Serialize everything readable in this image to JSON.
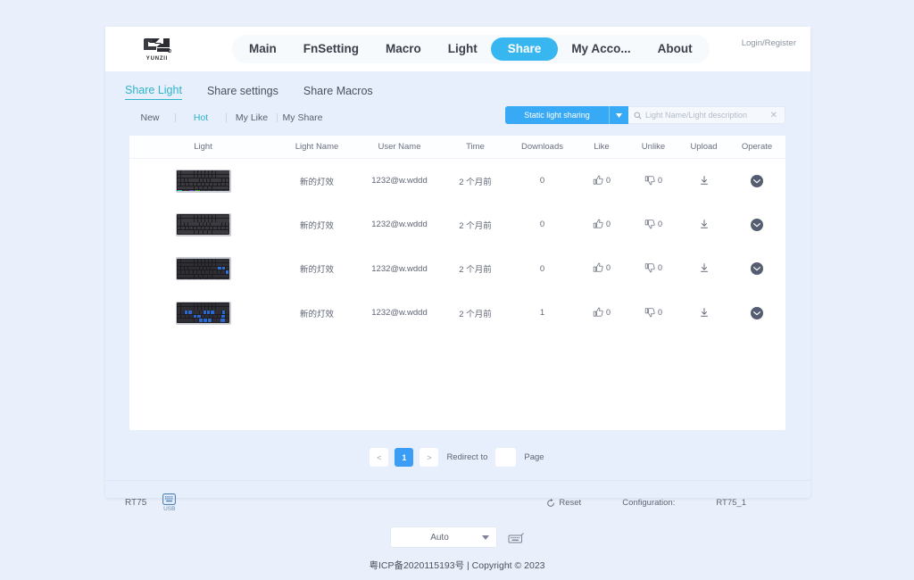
{
  "header": {
    "logo_text": "YUNZII",
    "logo_icon": "yunzii-logo-icon",
    "nav": [
      {
        "label": "Main",
        "active": false
      },
      {
        "label": "FnSetting",
        "active": false
      },
      {
        "label": "Macro",
        "active": false
      },
      {
        "label": "Light",
        "active": false
      },
      {
        "label": "Share",
        "active": true
      },
      {
        "label": "My Acco...",
        "active": false
      },
      {
        "label": "About",
        "active": false
      }
    ],
    "login_label": "Login/Register"
  },
  "subtabs": [
    {
      "label": "Share Light",
      "active": true
    },
    {
      "label": "Share settings",
      "active": false
    },
    {
      "label": "Share Macros",
      "active": false
    }
  ],
  "filters": [
    {
      "label": "New",
      "active": false
    },
    {
      "label": "Hot",
      "active": true
    },
    {
      "label": "My Like",
      "active": false
    },
    {
      "label": "My Share",
      "active": false
    }
  ],
  "toolbar": {
    "dropdown_label": "Static light sharing",
    "dropdown_icon": "chevron-down-icon",
    "search_icon": "search-icon",
    "search_placeholder": "Light Name/Light description",
    "search_value": "",
    "clear_icon": "close-icon"
  },
  "table": {
    "columns": [
      "Light",
      "Light Name",
      "User Name",
      "Time",
      "Downloads",
      "Like",
      "Unlike",
      "Upload",
      "Operate"
    ],
    "rows": [
      {
        "light_name": "新的灯效",
        "user_name": "1232@w.wddd",
        "time": "2 个月前",
        "downloads": "0",
        "like": "0",
        "unlike": "0",
        "upload_icon": "download-icon",
        "operate_icon": "check-circle-icon"
      },
      {
        "light_name": "新的灯效",
        "user_name": "1232@w.wddd",
        "time": "2 个月前",
        "downloads": "0",
        "like": "0",
        "unlike": "0",
        "upload_icon": "download-icon",
        "operate_icon": "check-circle-icon"
      },
      {
        "light_name": "新的灯效",
        "user_name": "1232@w.wddd",
        "time": "2 个月前",
        "downloads": "0",
        "like": "0",
        "unlike": "0",
        "upload_icon": "download-icon",
        "operate_icon": "check-circle-icon"
      },
      {
        "light_name": "新的灯效",
        "user_name": "1232@w.wddd",
        "time": "2 个月前",
        "downloads": "1",
        "like": "0",
        "unlike": "0",
        "upload_icon": "download-icon",
        "operate_icon": "check-circle-icon"
      }
    ]
  },
  "pagination": {
    "prev_label": "<",
    "next_label": ">",
    "current_page": "1",
    "redirect_label": "Redirect to",
    "page_label": "Page",
    "redirect_value": ""
  },
  "status_bar": {
    "device": "RT75",
    "connection_icon": "keyboard-usb-icon",
    "connection_label": "USB",
    "reset_icon": "refresh-icon",
    "reset_label": "Reset",
    "configuration_label": "Configuration:",
    "configuration_value": "RT75_1"
  },
  "footer": {
    "mode_label": "Auto",
    "mode_caret_icon": "chevron-down-icon",
    "keyboard_icon": "keyboard-icon",
    "copyright": "粤ICP备2020115193号 | Copyright © 2023"
  },
  "colors": {
    "accent_blue": "#38b6f0",
    "accent_teal": "#2fb3c9",
    "panel_bg": "#e7eefc",
    "page_bg": "#eaf0fb",
    "badge_dark": "#565d73"
  }
}
